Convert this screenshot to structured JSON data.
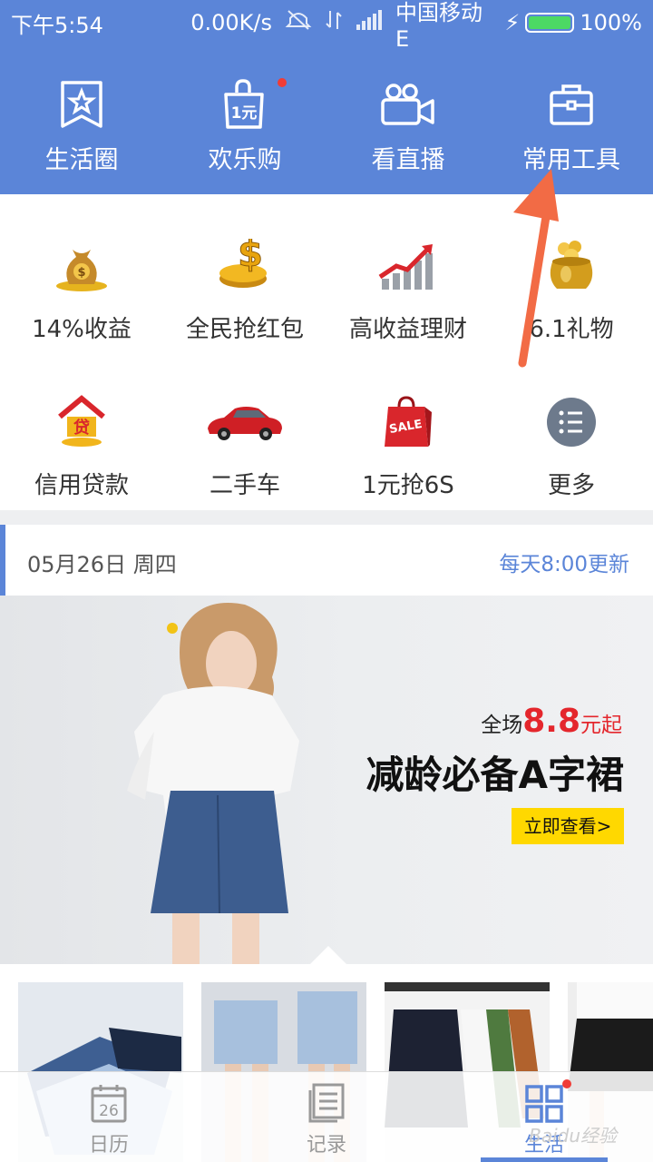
{
  "status_bar": {
    "time": "下午5:54",
    "speed": "0.00K/s",
    "carrier": "中国移动 E",
    "battery": "100%"
  },
  "top_nav": [
    {
      "label": "生活圈",
      "icon": "star-bookmark-icon"
    },
    {
      "label": "欢乐购",
      "icon": "shopping-bag-icon",
      "bag_text": "1元",
      "has_dot": true
    },
    {
      "label": "看直播",
      "icon": "video-camera-icon"
    },
    {
      "label": "常用工具",
      "icon": "toolbox-icon"
    }
  ],
  "services": [
    {
      "label": "14%收益",
      "icon": "money-bag-icon"
    },
    {
      "label": "全民抢红包",
      "icon": "gold-coin-icon"
    },
    {
      "label": "高收益理财",
      "icon": "growth-chart-icon"
    },
    {
      "label": "6.1礼物",
      "icon": "gold-pot-icon"
    },
    {
      "label": "信用贷款",
      "icon": "house-loan-icon"
    },
    {
      "label": "二手车",
      "icon": "red-car-icon"
    },
    {
      "label": "1元抢6S",
      "icon": "sale-bag-icon",
      "bag_text": "SALE"
    },
    {
      "label": "更多",
      "icon": "more-list-icon"
    }
  ],
  "feed": {
    "date": "05月26日 周四",
    "update_note": "每天8:00更新"
  },
  "banner": {
    "promo_prefix": "全场",
    "promo_price": "8.8",
    "promo_suffix": "元起",
    "headline": "减龄必备A字裙",
    "cta": "立即查看>"
  },
  "tabbar": [
    {
      "label": "日历",
      "icon": "calendar-icon",
      "day": "26",
      "active": false
    },
    {
      "label": "记录",
      "icon": "record-icon",
      "active": false
    },
    {
      "label": "生活",
      "icon": "life-grid-icon",
      "active": true,
      "has_dot": true
    }
  ],
  "watermark": "Baidu经验"
}
